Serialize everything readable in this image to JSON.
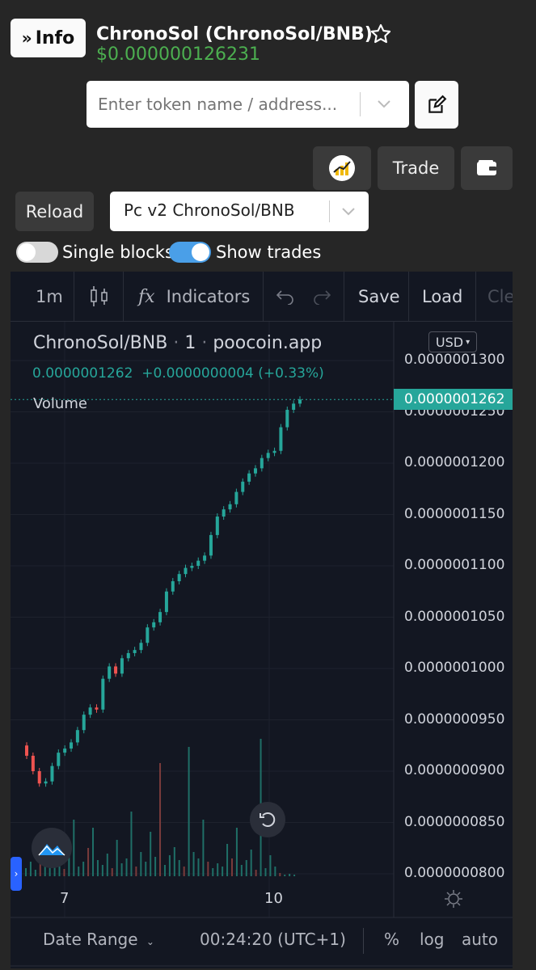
{
  "header": {
    "info_label": "Info",
    "token_title": "ChronoSol (ChronoSol/BNB)",
    "price": "$0.000000126231"
  },
  "search": {
    "placeholder": "Enter token name / address..."
  },
  "actions": {
    "trade_label": "Trade"
  },
  "controls": {
    "reload_label": "Reload",
    "pair_select": "Pc v2 ChronoSol/BNB",
    "single_blocks_label": "Single blocks",
    "single_blocks_on": false,
    "show_trades_label": "Show trades",
    "show_trades_on": true
  },
  "colors": {
    "accent": "#4a9fe8",
    "up": "#26a69a",
    "down": "#ef5350",
    "price_green": "#4caf50"
  },
  "chart": {
    "toolbar": {
      "interval": "1m",
      "indicators": "Indicators",
      "save": "Save",
      "load": "Load",
      "clear": "Cle"
    },
    "legend": {
      "symbol": "ChronoSol/BNB",
      "dot1": "·",
      "interval": "1",
      "dot2": "·",
      "source": "poocoin.app",
      "last": "0.0000001262",
      "change": "+0.0000000004 (+0.33%)",
      "volume": "Volume"
    },
    "currency": "USD",
    "last_price_label": "0.0000001262",
    "bottom": {
      "date_range": "Date Range",
      "time": "00:24:20 (UTC+1)",
      "percent": "%",
      "log": "log",
      "auto": "auto"
    }
  },
  "chart_data": {
    "type": "candlestick",
    "y_ticks": [
      "0.0000001300",
      "0.0000001250",
      "0.0000001200",
      "0.0000001150",
      "0.0000001100",
      "0.0000001050",
      "0.0000001000",
      "0.0000000950",
      "0.0000000900",
      "0.0000000850",
      "0.0000000800"
    ],
    "x_ticks": [
      "7",
      "10"
    ],
    "ylim": [
      8e-08,
      1.3e-07
    ],
    "close_points": [
      [
        0,
        9.15e-08
      ],
      [
        1,
        9e-08
      ],
      [
        2,
        8.88e-08
      ],
      [
        3,
        8.9e-08
      ],
      [
        4,
        9.05e-08
      ],
      [
        5,
        9.18e-08
      ],
      [
        6,
        9.22e-08
      ],
      [
        7,
        9.28e-08
      ],
      [
        8,
        9.4e-08
      ],
      [
        9,
        9.55e-08
      ],
      [
        10,
        9.62e-08
      ],
      [
        11,
        9.6e-08
      ],
      [
        12,
        9.9e-08
      ],
      [
        13,
        1.002e-07
      ],
      [
        14,
        9.95e-08
      ],
      [
        15,
        1.01e-07
      ],
      [
        16,
        1.015e-07
      ],
      [
        17,
        1.018e-07
      ],
      [
        18,
        1.025e-07
      ],
      [
        19,
        1.04e-07
      ],
      [
        20,
        1.045e-07
      ],
      [
        21,
        1.055e-07
      ],
      [
        22,
        1.075e-07
      ],
      [
        23,
        1.085e-07
      ],
      [
        24,
        1.092e-07
      ],
      [
        25,
        1.098e-07
      ],
      [
        26,
        1.1e-07
      ],
      [
        27,
        1.105e-07
      ],
      [
        28,
        1.11e-07
      ],
      [
        29,
        1.13e-07
      ],
      [
        30,
        1.148e-07
      ],
      [
        31,
        1.155e-07
      ],
      [
        32,
        1.16e-07
      ],
      [
        33,
        1.172e-07
      ],
      [
        34,
        1.182e-07
      ],
      [
        35,
        1.19e-07
      ],
      [
        36,
        1.195e-07
      ],
      [
        37,
        1.205e-07
      ],
      [
        38,
        1.21e-07
      ],
      [
        39,
        1.212e-07
      ],
      [
        40,
        1.235e-07
      ],
      [
        41,
        1.252e-07
      ],
      [
        42,
        1.258e-07
      ],
      [
        43,
        1.262e-07
      ]
    ]
  }
}
